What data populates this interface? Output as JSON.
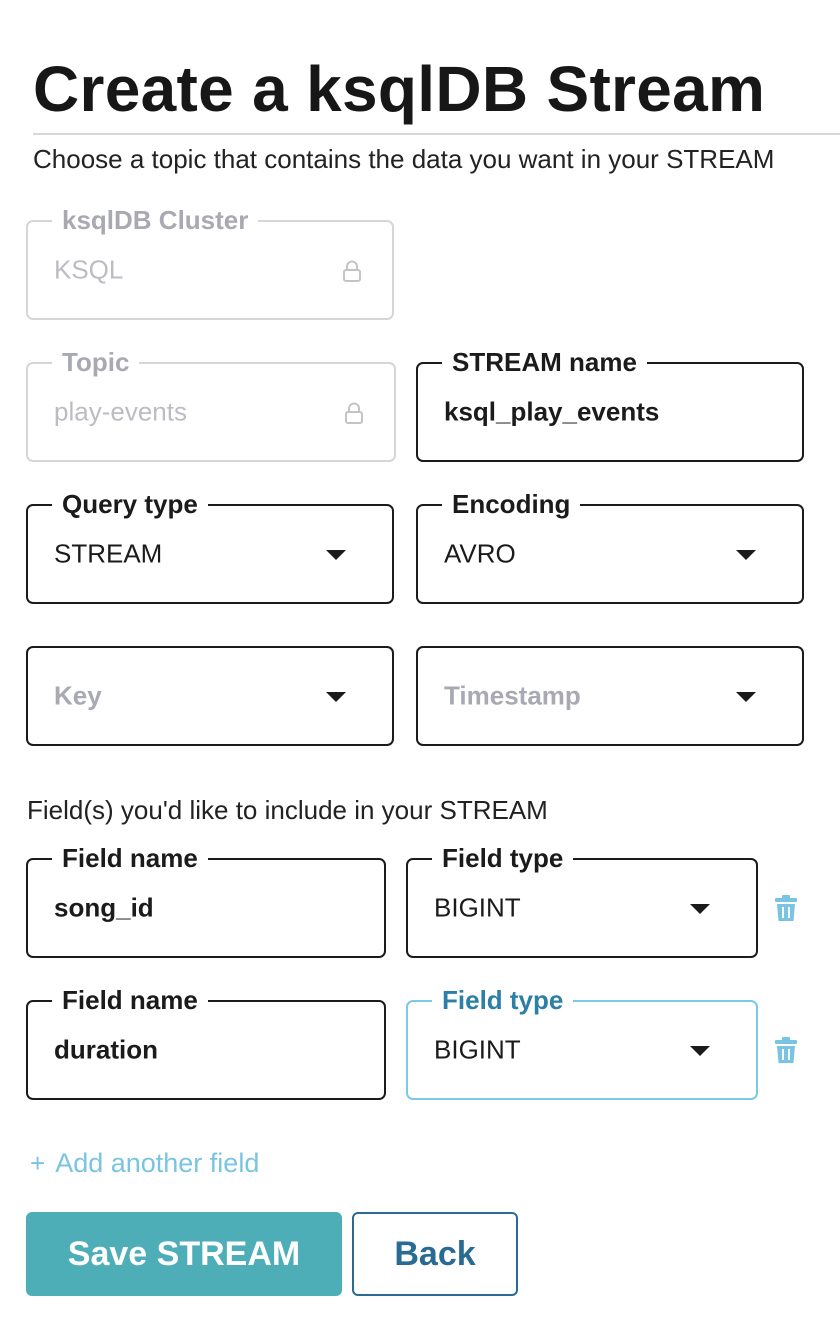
{
  "header": {
    "title": "Create a ksqlDB Stream",
    "subtitle": "Choose a topic that contains the data you want in your STREAM"
  },
  "form": {
    "cluster": {
      "label": "ksqlDB Cluster",
      "value": "KSQL",
      "icon": "lock-icon"
    },
    "topic": {
      "label": "Topic",
      "value": "play-events",
      "icon": "lock-icon"
    },
    "stream_name": {
      "label": "STREAM name",
      "value": "ksql_play_events"
    },
    "query_type": {
      "label": "Query type",
      "value": "STREAM"
    },
    "encoding": {
      "label": "Encoding",
      "value": "AVRO"
    },
    "key": {
      "placeholder": "Key"
    },
    "timestamp": {
      "placeholder": "Timestamp"
    }
  },
  "fields_section": {
    "label": "Field(s) you'd like to include in your STREAM",
    "rows": [
      {
        "name_label": "Field name",
        "name_value": "song_id",
        "type_label": "Field type",
        "type_value": "BIGINT"
      },
      {
        "name_label": "Field name",
        "name_value": "duration",
        "type_label": "Field type",
        "type_value": "BIGINT"
      }
    ],
    "add_label": "Add another field",
    "add_icon": "plus-icon",
    "delete_icon": "trash-icon"
  },
  "actions": {
    "save_label": "Save STREAM",
    "back_label": "Back"
  },
  "colors": {
    "primary": "#4eaeb8",
    "secondary_text": "#2a6b93",
    "focus_border": "#7ac9e8",
    "icon_accent": "#7ac4e3",
    "disabled": "#d6d6d6"
  }
}
